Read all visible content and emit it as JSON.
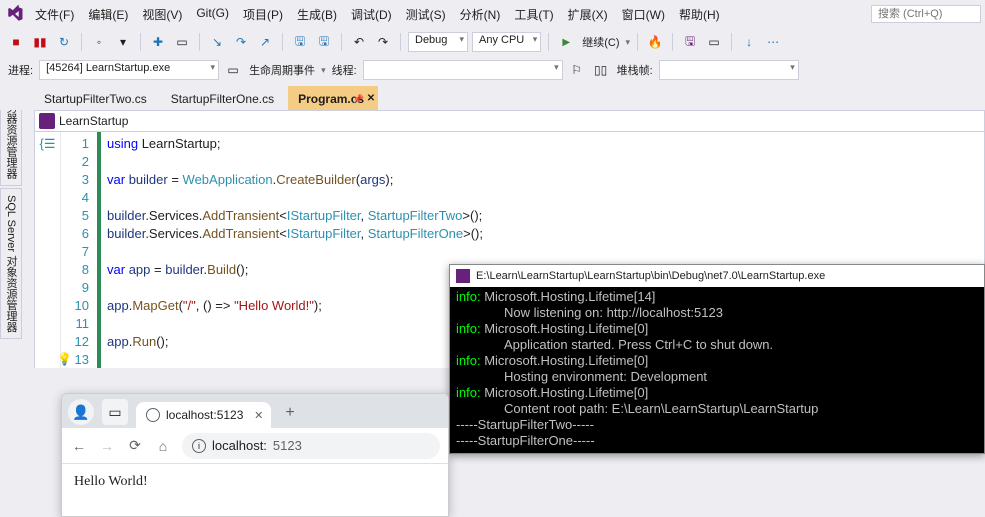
{
  "menu": {
    "items": [
      "文件(F)",
      "编辑(E)",
      "视图(V)",
      "Git(G)",
      "项目(P)",
      "生成(B)",
      "调试(D)",
      "测试(S)",
      "分析(N)",
      "工具(T)",
      "扩展(X)",
      "窗口(W)",
      "帮助(H)"
    ],
    "search_placeholder": "搜索 (Ctrl+Q)"
  },
  "toolbar1": {
    "config": "Debug",
    "platform": "Any CPU",
    "continue": "继续(C)"
  },
  "toolbar2": {
    "process_label": "进程:",
    "process_value": "[45264] LearnStartup.exe",
    "lifecycle": "生命周期事件",
    "thread_label": "线程:",
    "stackframe_label": "堆栈帧:"
  },
  "left_rail": [
    "服务器资源管理器",
    "SQL Server 对象资源管理器"
  ],
  "tabs": {
    "items": [
      "StartupFilterTwo.cs",
      "StartupFilterOne.cs",
      "Program.cs"
    ],
    "active_index": 2
  },
  "breadcrumb": "LearnStartup",
  "code": {
    "line_count": 13,
    "lines": [
      {
        "n": 1,
        "seg": [
          [
            "kw",
            "using"
          ],
          [
            "plain",
            " LearnStartup;"
          ]
        ]
      },
      {
        "n": 2,
        "seg": []
      },
      {
        "n": 3,
        "seg": [
          [
            "kw",
            "var"
          ],
          [
            "plain",
            " "
          ],
          [
            "ident",
            "builder"
          ],
          [
            "plain",
            " = "
          ],
          [
            "type",
            "WebApplication"
          ],
          [
            "plain",
            "."
          ],
          [
            "mtd",
            "CreateBuilder"
          ],
          [
            "plain",
            "("
          ],
          [
            "ident",
            "args"
          ],
          [
            "plain",
            ");"
          ]
        ]
      },
      {
        "n": 4,
        "seg": []
      },
      {
        "n": 5,
        "seg": [
          [
            "ident",
            "builder"
          ],
          [
            "plain",
            ".Services."
          ],
          [
            "mtd",
            "AddTransient"
          ],
          [
            "plain",
            "<"
          ],
          [
            "type",
            "IStartupFilter"
          ],
          [
            "plain",
            ", "
          ],
          [
            "type",
            "StartupFilterTwo"
          ],
          [
            "plain",
            ">();"
          ]
        ]
      },
      {
        "n": 6,
        "seg": [
          [
            "ident",
            "builder"
          ],
          [
            "plain",
            ".Services."
          ],
          [
            "mtd",
            "AddTransient"
          ],
          [
            "plain",
            "<"
          ],
          [
            "type",
            "IStartupFilter"
          ],
          [
            "plain",
            ", "
          ],
          [
            "type",
            "StartupFilterOne"
          ],
          [
            "plain",
            ">();"
          ]
        ]
      },
      {
        "n": 7,
        "seg": []
      },
      {
        "n": 8,
        "seg": [
          [
            "kw",
            "var"
          ],
          [
            "plain",
            " "
          ],
          [
            "ident",
            "app"
          ],
          [
            "plain",
            " = "
          ],
          [
            "ident",
            "builder"
          ],
          [
            "plain",
            "."
          ],
          [
            "mtd",
            "Build"
          ],
          [
            "plain",
            "();"
          ]
        ]
      },
      {
        "n": 9,
        "seg": []
      },
      {
        "n": 10,
        "seg": [
          [
            "ident",
            "app"
          ],
          [
            "plain",
            "."
          ],
          [
            "mtd",
            "MapGet"
          ],
          [
            "plain",
            "("
          ],
          [
            "str",
            "\"/\""
          ],
          [
            "plain",
            ", () => "
          ],
          [
            "str",
            "\"Hello World!\""
          ],
          [
            "plain",
            ");"
          ]
        ]
      },
      {
        "n": 11,
        "seg": []
      },
      {
        "n": 12,
        "seg": [
          [
            "ident",
            "app"
          ],
          [
            "plain",
            "."
          ],
          [
            "mtd",
            "Run"
          ],
          [
            "plain",
            "();"
          ]
        ]
      },
      {
        "n": 13,
        "seg": []
      }
    ]
  },
  "console": {
    "title": "E:\\Learn\\LearnStartup\\LearnStartup\\bin\\Debug\\net7.0\\LearnStartup.exe",
    "lines": [
      {
        "tag": "info",
        "head": "info: ",
        "text": "Microsoft.Hosting.Lifetime[14]"
      },
      {
        "tag": "cont",
        "text": "Now listening on: http://localhost:5123"
      },
      {
        "tag": "info",
        "head": "info: ",
        "text": "Microsoft.Hosting.Lifetime[0]"
      },
      {
        "tag": "cont",
        "text": "Application started. Press Ctrl+C to shut down."
      },
      {
        "tag": "info",
        "head": "info: ",
        "text": "Microsoft.Hosting.Lifetime[0]"
      },
      {
        "tag": "cont",
        "text": "Hosting environment: Development"
      },
      {
        "tag": "info",
        "head": "info: ",
        "text": "Microsoft.Hosting.Lifetime[0]"
      },
      {
        "tag": "cont",
        "text": "Content root path: E:\\Learn\\LearnStartup\\LearnStartup"
      },
      {
        "tag": "plain",
        "text": "-----StartupFilterTwo-----"
      },
      {
        "tag": "plain",
        "text": "-----StartupFilterOne-----"
      }
    ]
  },
  "browser": {
    "tab_title": "localhost:5123",
    "address_host": "localhost:",
    "address_port": "5123",
    "body": "Hello World!"
  }
}
